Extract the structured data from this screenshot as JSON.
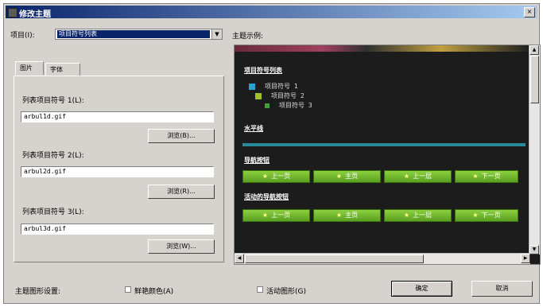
{
  "window": {
    "title": "修改主题",
    "close_label": "×"
  },
  "item": {
    "label": "项目(I):",
    "selected": "项目符号列表"
  },
  "preview_label": "主题示例:",
  "tabs": [
    {
      "label": "图片"
    },
    {
      "label": "字体"
    }
  ],
  "bullets": [
    {
      "label": "列表项目符号 1(L):",
      "value": "arbul1d.gif",
      "browse": "浏览(B)..."
    },
    {
      "label": "列表项目符号 2(L):",
      "value": "arbul2d.gif",
      "browse": "浏览(R)..."
    },
    {
      "label": "列表项目符号 3(L):",
      "value": "arbul3d.gif",
      "browse": "浏览(W)..."
    }
  ],
  "preview": {
    "heading1": "项目符号列表",
    "list": [
      "项目符号 1",
      "项目符号 2",
      "项目符号 3"
    ],
    "heading2": "水平线",
    "heading3": "导航按钮",
    "heading4": "活动的导航按钮",
    "nav_buttons": [
      "上一页",
      "主页",
      "上一层",
      "下一页"
    ],
    "colors": {
      "bullet1": "#30a0d0",
      "bullet2": "#a0c030",
      "bullet3": "#40a040",
      "nav_green": "#6ab82a",
      "hr": "#2a8a9a"
    }
  },
  "footer": {
    "theme_label": "主题图形设置:",
    "bright_colors": "鲜艳颜色(A)",
    "active_graphics": "活动图形(G)",
    "ok": "确定",
    "cancel": "取消"
  }
}
